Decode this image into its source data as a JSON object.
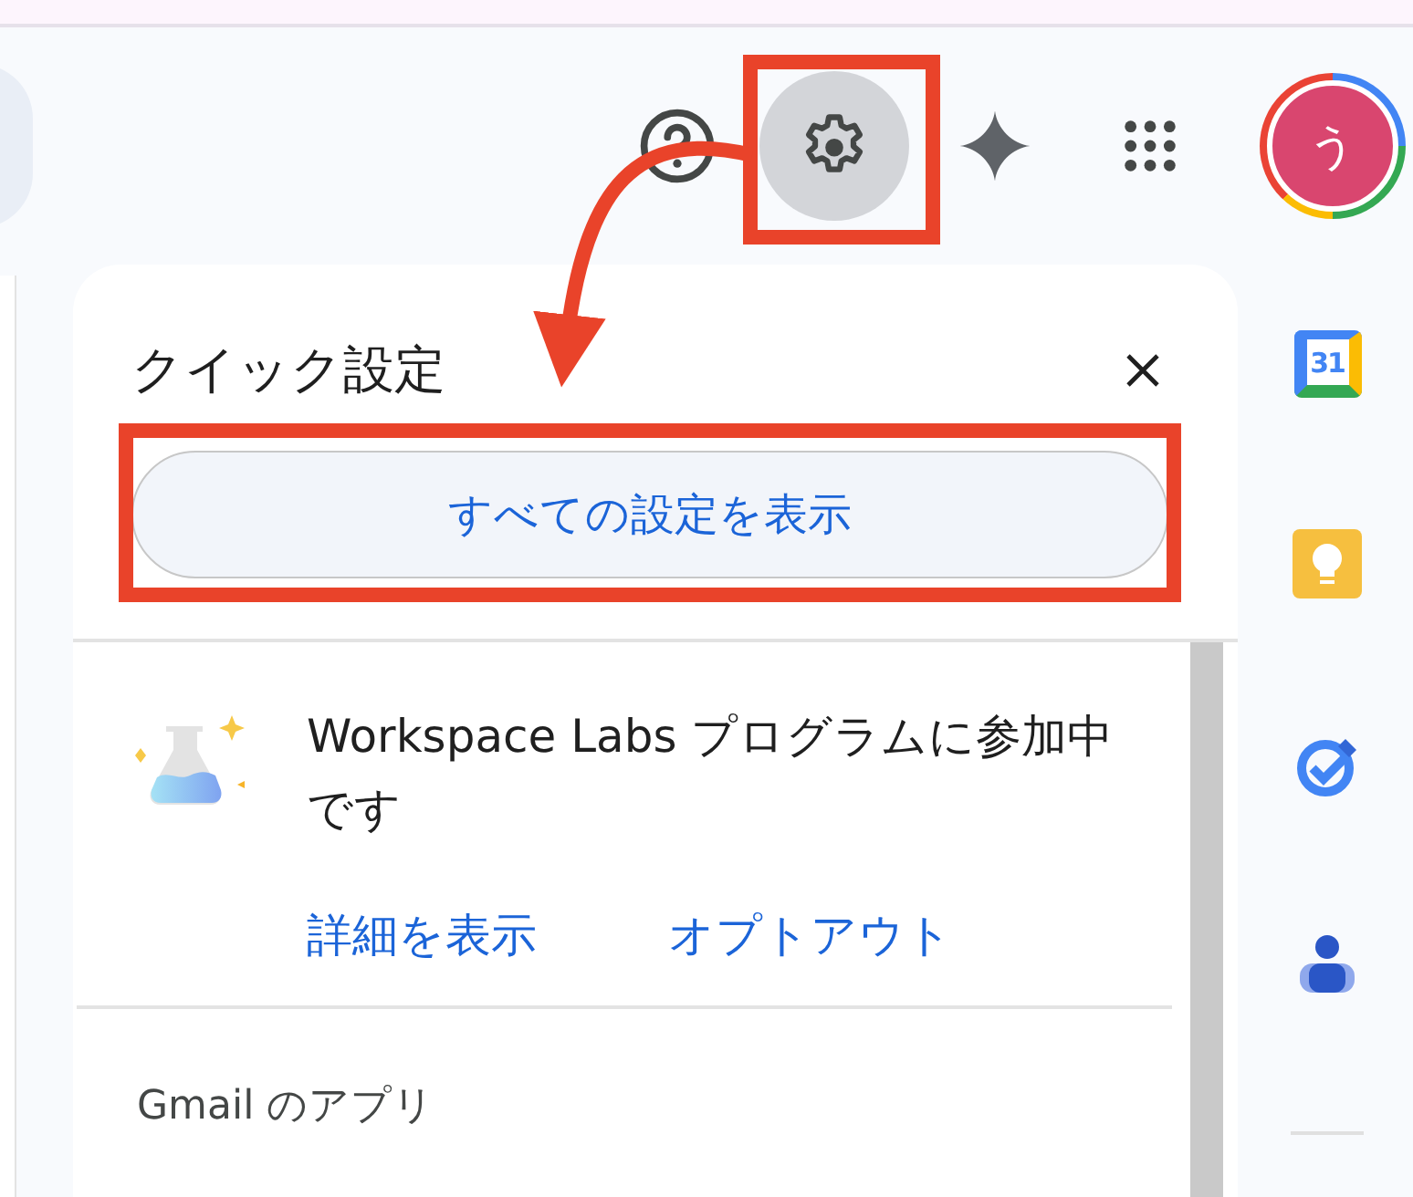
{
  "header": {
    "avatar_letter": "う"
  },
  "quick_settings": {
    "title": "クイック設定",
    "all_settings_button": "すべての設定を表示",
    "labs": {
      "message": "Workspace Labs プログラムに参加中です",
      "links": [
        "詳細を表示",
        "オプトアウト"
      ]
    },
    "section_heading": "Gmail のアプリ"
  },
  "side_panel": {
    "calendar_day": "31"
  }
}
